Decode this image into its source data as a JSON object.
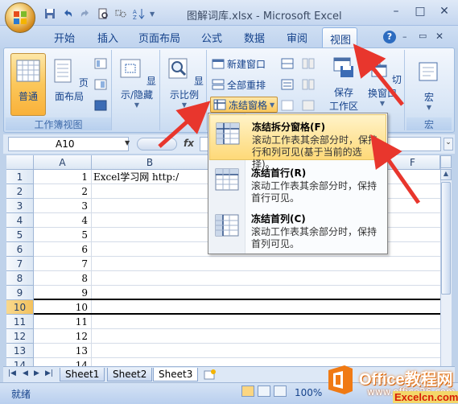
{
  "window": {
    "title": "图解词库.xlsx - Microsoft Excel",
    "minimize": "–",
    "restore": "□",
    "close": "✕"
  },
  "tabs": [
    {
      "label": "开始"
    },
    {
      "label": "插入"
    },
    {
      "label": "页面布局"
    },
    {
      "label": "公式"
    },
    {
      "label": "数据"
    },
    {
      "label": "审阅"
    },
    {
      "label": "视图"
    }
  ],
  "help": "?",
  "ribbon": {
    "workbook_views": {
      "label": "工作簿视图",
      "normal": "普通",
      "page_layout": "页面布局"
    },
    "show_hide": {
      "label": "显示/隐藏"
    },
    "zoom": {
      "label": "显示比例"
    },
    "window": {
      "new_window": "新建窗口",
      "arrange_all": "全部重排",
      "freeze_panes": "冻结窗格",
      "save_workspace": "保存",
      "workspace": "工作区",
      "switch_windows": "切换窗口"
    },
    "macros": {
      "label": "宏",
      "button": "宏"
    }
  },
  "formula_bar": {
    "name_box": "A10",
    "fx": "fx",
    "value": ""
  },
  "grid": {
    "columns": [
      "A",
      "B",
      "F"
    ],
    "rows": [
      "1",
      "2",
      "3",
      "4",
      "5",
      "6",
      "7",
      "8",
      "9",
      "10",
      "11",
      "12",
      "13",
      "14"
    ],
    "col_a_values": [
      "1",
      "2",
      "3",
      "4",
      "5",
      "6",
      "7",
      "8",
      "9",
      "10",
      "11",
      "12",
      "13",
      "14"
    ],
    "b1": "Excel学习网 http:/"
  },
  "freeze_menu": {
    "items": [
      {
        "title": "冻结拆分窗格(F)",
        "desc": "滚动工作表其余部分时，保持行和列可见(基于当前的选择)。"
      },
      {
        "title": "冻结首行(R)",
        "desc": "滚动工作表其余部分时，保持首行可见。"
      },
      {
        "title": "冻结首列(C)",
        "desc": "滚动工作表其余部分时，保持首列可见。"
      }
    ]
  },
  "sheets": [
    {
      "name": "Sheet1"
    },
    {
      "name": "Sheet2"
    },
    {
      "name": "Sheet3"
    }
  ],
  "status": {
    "ready": "就绪",
    "zoom": "100%"
  },
  "watermark": {
    "brand": "Office教程网",
    "url": "www.office26.com",
    "site": "Excelcn.com"
  },
  "colors": {
    "accent": "#fbc75a",
    "ribbon_text": "#15428b",
    "arrow": "#e8362d"
  }
}
